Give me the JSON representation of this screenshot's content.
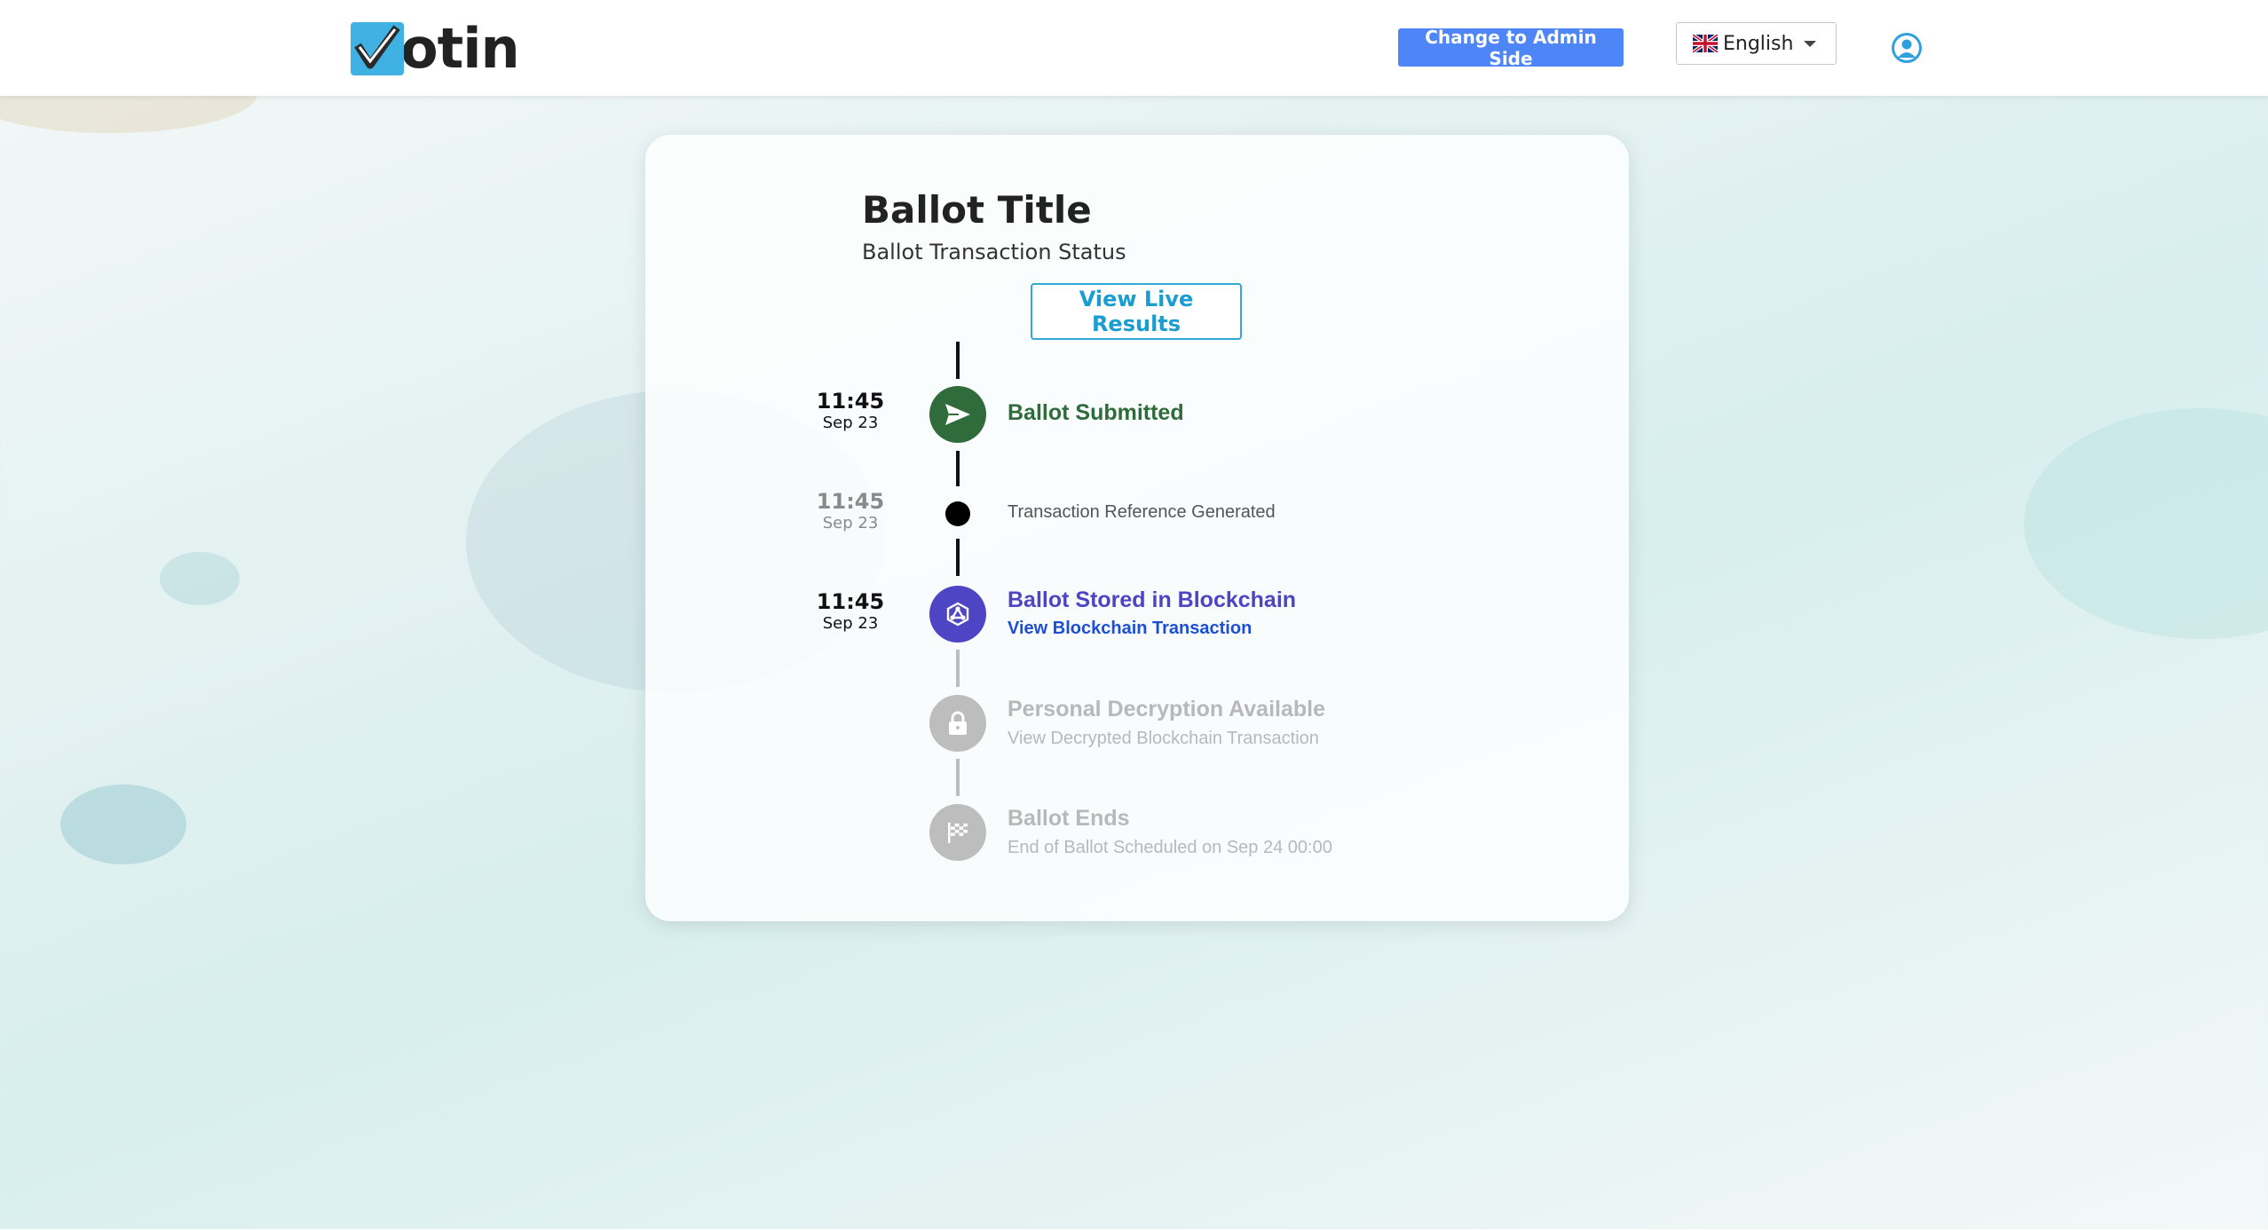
{
  "header": {
    "logo_text": "otin",
    "admin_button": "Change to Admin Side",
    "language": "English",
    "icons": {
      "logo": "votin-check-logo-icon",
      "flag": "uk-flag-icon",
      "dropdown": "caret-down-icon",
      "user": "user-avatar-icon"
    }
  },
  "ballot": {
    "title": "Ballot Title",
    "subtitle": "Ballot Transaction Status",
    "live_results_button": "View Live Results"
  },
  "timeline": [
    {
      "time": "11:45",
      "date": "Sep 23",
      "title": "Ballot Submitted",
      "subtitle": "",
      "icon": "send-icon",
      "state": "complete",
      "color": "#2f6b3b"
    },
    {
      "time": "11:45",
      "date": "Sep 23",
      "title": "Transaction Reference Generated",
      "subtitle": "",
      "icon": "dot-icon",
      "state": "complete",
      "color": "#000000"
    },
    {
      "time": "11:45",
      "date": "Sep 23",
      "title": "Ballot Stored in Blockchain",
      "subtitle": "View Blockchain Transaction",
      "icon": "blockchain-icon",
      "state": "complete",
      "color": "#4d45c3"
    },
    {
      "time": "",
      "date": "",
      "title": "Personal Decryption Available",
      "subtitle": "View Decrypted Blockchain Transaction",
      "icon": "lock-icon",
      "state": "pending",
      "color": "#bdbdbd"
    },
    {
      "time": "",
      "date": "",
      "title": "Ballot Ends",
      "subtitle": "End of Ballot Scheduled on Sep 24 00:00",
      "icon": "checkered-flag-icon",
      "state": "pending",
      "color": "#bdbdbd"
    }
  ],
  "colors": {
    "accent": "#4f86f7",
    "live_results": "#31a9d6",
    "link": "#1c4fd6"
  }
}
